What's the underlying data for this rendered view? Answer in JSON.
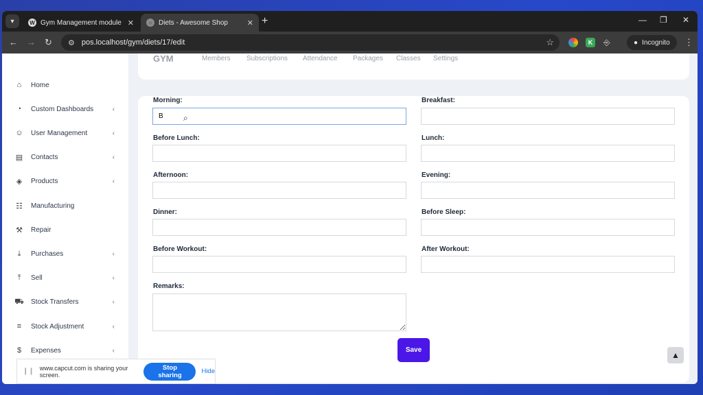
{
  "browser": {
    "tabs": [
      {
        "label": "Gym Management module for",
        "favicon": "W"
      },
      {
        "label": "Diets - Awesome Shop",
        "favicon": "○"
      }
    ],
    "url": "pos.localhost/gym/diets/17/edit",
    "incognito_label": "Incognito",
    "extension_k": "K"
  },
  "sidebar": {
    "items": [
      {
        "label": "Home",
        "icon": "home-icon",
        "glyph": "⌂",
        "chevron": ""
      },
      {
        "label": "Custom Dashboards",
        "icon": "dashboard-icon",
        "glyph": "◔",
        "chevron": "‹"
      },
      {
        "label": "User Management",
        "icon": "users-icon",
        "glyph": "☺",
        "chevron": "‹"
      },
      {
        "label": "Contacts",
        "icon": "contacts-icon",
        "glyph": "▤",
        "chevron": "‹"
      },
      {
        "label": "Products",
        "icon": "cube-icon",
        "glyph": "◈",
        "chevron": "‹"
      },
      {
        "label": "Manufacturing",
        "icon": "factory-icon",
        "glyph": "☷",
        "chevron": ""
      },
      {
        "label": "Repair",
        "icon": "wrench-icon",
        "glyph": "⚒",
        "chevron": ""
      },
      {
        "label": "Purchases",
        "icon": "download-icon",
        "glyph": "⤓",
        "chevron": "‹"
      },
      {
        "label": "Sell",
        "icon": "upload-icon",
        "glyph": "⤒",
        "chevron": "‹"
      },
      {
        "label": "Stock Transfers",
        "icon": "truck-icon",
        "glyph": "⛟",
        "chevron": "‹"
      },
      {
        "label": "Stock Adjustment",
        "icon": "database-icon",
        "glyph": "≡",
        "chevron": "‹"
      },
      {
        "label": "Expenses",
        "icon": "money-icon",
        "glyph": "$",
        "chevron": "‹"
      }
    ]
  },
  "topnav": {
    "logo": "GYM",
    "items": [
      "Members",
      "Subscriptions",
      "Attendance",
      "Packages",
      "Classes",
      "Settings"
    ]
  },
  "form": {
    "morning_label": "Morning:",
    "morning_value": "B",
    "breakfast_label": "Breakfast:",
    "before_lunch_label": "Before Lunch:",
    "lunch_label": "Lunch:",
    "afternoon_label": "Afternoon:",
    "evening_label": "Evening:",
    "dinner_label": "Dinner:",
    "before_sleep_label": "Before Sleep:",
    "before_workout_label": "Before Workout:",
    "after_workout_label": "After Workout:",
    "remarks_label": "Remarks:",
    "save_label": "Save"
  },
  "sharebar": {
    "message": "www.capcut.com is sharing your screen.",
    "stop_label": "Stop sharing",
    "hide_label": "Hide"
  }
}
